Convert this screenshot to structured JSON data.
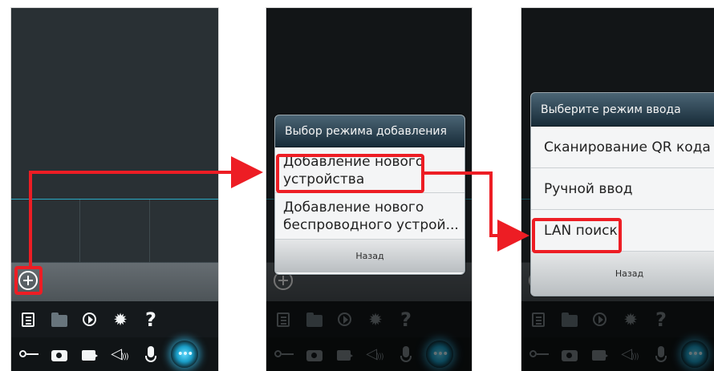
{
  "panels": [
    {
      "id": "main-screen",
      "icons": {
        "add": "plus-circle-icon",
        "toolbar_top": [
          "list-icon",
          "folder-icon",
          "playback-icon",
          "gear-icon",
          "help-icon"
        ],
        "toolbar_bottom": [
          "key-icon",
          "camera-icon",
          "video-camera-icon",
          "speaker-icon",
          "microphone-icon",
          "more-icon"
        ]
      }
    },
    {
      "id": "add-mode-screen",
      "dialog": {
        "title": "Выбор режима добавления",
        "options": [
          {
            "line1": "Добавление нового",
            "line2": "устройства"
          },
          {
            "line1": "Добавление нового",
            "line2": "беспроводного устрой..."
          }
        ],
        "back_label": "Назад"
      }
    },
    {
      "id": "input-mode-screen",
      "dialog": {
        "title": "Выберите режим ввода",
        "options": [
          "Сканирование QR кода",
          "Ручной ввод",
          "LAN поиск"
        ],
        "back_label": "Назад"
      }
    }
  ],
  "colors": {
    "highlight": "#ed1d24",
    "accent": "#28aac4",
    "dialog_title_background": "#172b38"
  }
}
